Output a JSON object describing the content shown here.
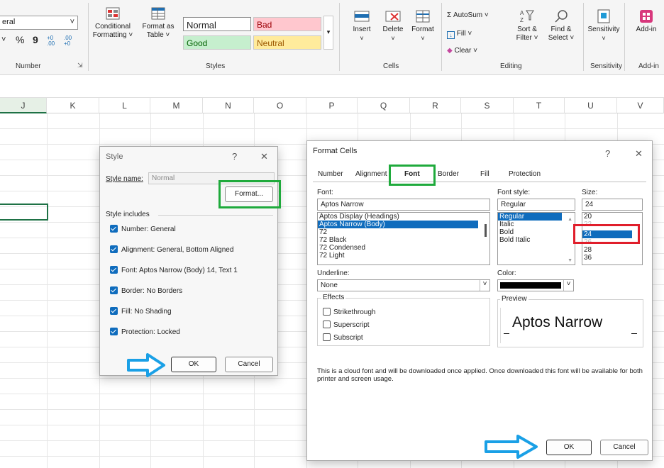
{
  "ribbon": {
    "number_format_value": "eral",
    "number_group_label": "Number",
    "percent_symbol": "%",
    "comma_symbol": "9",
    "inc_decimal": "+0 .00",
    "dec_decimal": ".00 +0",
    "conditional_formatting": [
      "Conditional",
      "Formatting ˅"
    ],
    "format_as_table": [
      "Format as",
      "Table ˅"
    ],
    "styles": {
      "normal": "Normal",
      "bad": "Bad",
      "good": "Good",
      "neutral": "Neutral",
      "group_label": "Styles"
    },
    "cells": {
      "insert": "Insert",
      "delete": "Delete",
      "format": "Format",
      "group_label": "Cells"
    },
    "editing": {
      "autosum": "Σ AutoSum",
      "fill": "Fill ˅",
      "clear": "Clear ˅",
      "sort_filter": [
        "Sort &",
        "Filter ˅"
      ],
      "find_select": [
        "Find &",
        "Select ˅"
      ],
      "group_label": "Editing"
    },
    "sensitivity": {
      "label": "Sensitivity",
      "group_label": "Sensitivity"
    },
    "addins": {
      "label": "Add-in",
      "group_label": "Add-in"
    }
  },
  "columns": [
    "J",
    "K",
    "L",
    "M",
    "N",
    "O",
    "P",
    "Q",
    "R",
    "S",
    "T",
    "U",
    "V"
  ],
  "style_dialog": {
    "title": "Style",
    "help": "?",
    "close": "✕",
    "style_name_label": "Style name:",
    "style_name_value": "Normal",
    "format_button": "Format...",
    "style_includes_label": "Style includes",
    "includes": [
      "Number: General",
      "Alignment: General, Bottom Aligned",
      "Font: Aptos Narrow (Body) 14, Text 1",
      "Border: No Borders",
      "Fill: No Shading",
      "Protection: Locked"
    ],
    "ok": "OK",
    "cancel": "Cancel"
  },
  "format_cells": {
    "title": "Format Cells",
    "help": "?",
    "close": "✕",
    "tabs": [
      "Number",
      "Alignment",
      "Font",
      "Border",
      "Fill",
      "Protection"
    ],
    "active_tab": "Font",
    "font_label": "Font:",
    "font_value": "Aptos Narrow",
    "font_list": [
      "Aptos Display (Headings)",
      "Aptos Narrow (Body)",
      "72",
      "72 Black",
      "72 Condensed",
      "72 Light"
    ],
    "font_selected": "Aptos Narrow (Body)",
    "style_label": "Font style:",
    "style_value": "Regular",
    "style_list": [
      "Regular",
      "Italic",
      "Bold",
      "Bold Italic"
    ],
    "style_selected": "Regular",
    "size_label": "Size:",
    "size_value": "24",
    "size_list": [
      "20",
      "22",
      "24",
      "26",
      "28",
      "36"
    ],
    "size_selected": "24",
    "underline_label": "Underline:",
    "underline_value": "None",
    "color_label": "Color:",
    "color_value": "#000000",
    "effects_label": "Effects",
    "effects": [
      "Strikethrough",
      "Superscript",
      "Subscript"
    ],
    "preview_label": "Preview",
    "preview_text": "Aptos Narrow",
    "note": "This is a cloud font and will be downloaded once applied. Once downloaded this font will be available for both printer and screen usage.",
    "ok": "OK",
    "cancel": "Cancel"
  },
  "highlight_colors": {
    "green": "#1faa3c",
    "red": "#e01e2b",
    "arrow": "#1aa0e6"
  }
}
